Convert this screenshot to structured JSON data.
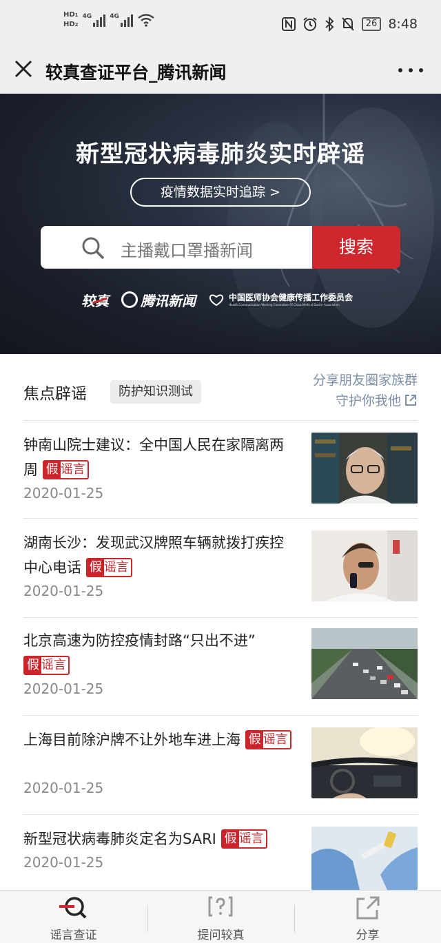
{
  "status_bar": {
    "hd1": "HD",
    "hd2": "HD",
    "sim1": "1",
    "sim2": "2",
    "network1": "4G",
    "network2": "4G",
    "battery": "26",
    "time": "8:48"
  },
  "title_bar": {
    "title": "较真查证平台_腾讯新闻"
  },
  "hero": {
    "title": "新型冠状病毒肺炎实时辟谣",
    "track_button": "疫情数据实时追踪 >",
    "search_placeholder": "主播戴口罩播新闻",
    "search_button": "搜索",
    "logo_jiaozhen": "较真",
    "logo_tencent": "腾讯新闻",
    "logo_assoc_cn": "中国医师协会健康传播工作委员会",
    "logo_assoc_en": "Health Communication Working Committee Of China Medical Doctor Association"
  },
  "focus": {
    "title": "焦点辟谣",
    "quiz_tag": "防护知识测试",
    "share_line1": "分享朋友圈家族群",
    "share_line2": "守护你我他"
  },
  "tag": {
    "fake": "假",
    "rumor": "谣言"
  },
  "news": [
    {
      "title": "钟南山院士建议：全中国人民在家隔离两周",
      "date": "2020-01-25"
    },
    {
      "title": "湖南长沙：发现武汉牌照车辆就拨打疾控中心电话",
      "date": "2020-01-25"
    },
    {
      "title": "北京高速为防控疫情封路“只出不进”",
      "date": "2020-01-25"
    },
    {
      "title": "上海目前除沪牌不让外地车进上海",
      "date": "2020-01-25"
    },
    {
      "title": "新型冠状病毒肺炎定名为SARI",
      "date": "2020-01-25"
    }
  ],
  "bottom_nav": [
    {
      "label": "谣言查证"
    },
    {
      "label": "提问较真"
    },
    {
      "label": "分享"
    }
  ],
  "colors": {
    "brand_red": "#d0262d",
    "link_blue": "#7e8fa8",
    "hero_dark": "#1a1f2a"
  }
}
